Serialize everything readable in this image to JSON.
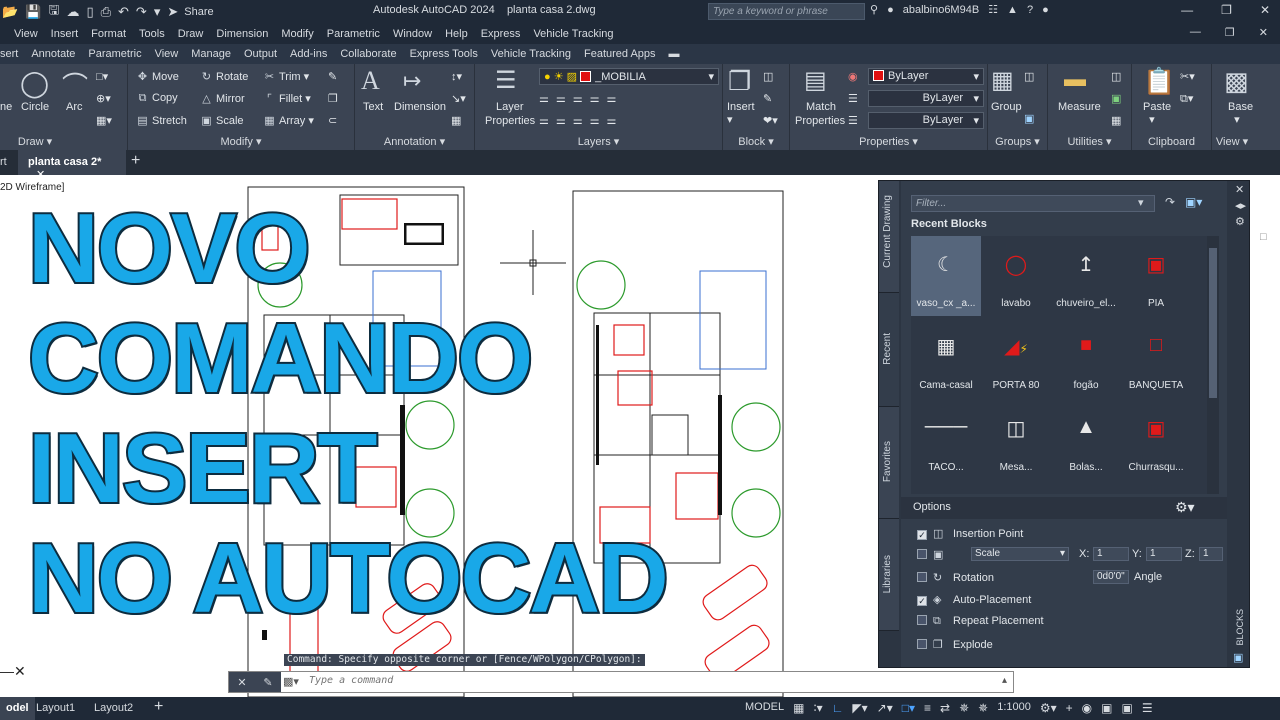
{
  "titlebar": {
    "share": "Share",
    "app_title": "Autodesk AutoCAD 2024",
    "file_name": "planta casa 2.dwg",
    "search_placeholder": "Type a keyword or phrase",
    "user": "abalbino6M94B"
  },
  "menu": [
    "View",
    "Insert",
    "Format",
    "Tools",
    "Draw",
    "Dimension",
    "Modify",
    "Parametric",
    "Window",
    "Help",
    "Express",
    "Vehicle Tracking"
  ],
  "ribbon_tabs": [
    "sert",
    "Annotate",
    "Parametric",
    "View",
    "Manage",
    "Output",
    "Add-ins",
    "Collaborate",
    "Express Tools",
    "Vehicle Tracking",
    "Featured Apps"
  ],
  "ribbon": {
    "draw": {
      "title": "Draw",
      "line": "ne",
      "circle": "Circle",
      "arc": "Arc"
    },
    "modify": {
      "title": "Modify",
      "move": "Move",
      "rotate": "Rotate",
      "trim": "Trim",
      "copy": "Copy",
      "mirror": "Mirror",
      "fillet": "Fillet",
      "stretch": "Stretch",
      "scale": "Scale",
      "array": "Array"
    },
    "annotation": {
      "title": "Annotation",
      "text": "Text",
      "dimension": "Dimension"
    },
    "layers": {
      "title": "Layers",
      "properties_line1": "Layer",
      "properties_line2": "Properties",
      "current_layer": "_MOBILIA"
    },
    "block": {
      "title": "Block",
      "insert": "Insert"
    },
    "properties": {
      "title": "Properties",
      "match_line1": "Match",
      "match_line2": "Properties",
      "color": "ByLayer",
      "linetype": "ByLayer",
      "lineweight": "ByLayer"
    },
    "groups": {
      "title": "Groups",
      "group": "Group"
    },
    "utilities": {
      "title": "Utilities",
      "measure": "Measure"
    },
    "clipboard": {
      "title": "Clipboard",
      "paste": "Paste"
    },
    "view": {
      "title": "View",
      "base": "Base"
    }
  },
  "doc_tabs": {
    "start": "rt",
    "active": "planta casa 2*"
  },
  "viewport_label": "2D Wireframe]",
  "overlay_text": [
    "NOVO",
    "COMANDO",
    "INSERT",
    "NO AUTOCAD"
  ],
  "blocks_palette": {
    "side_tabs": [
      "Current Drawing",
      "Recent",
      "Favorites",
      "Libraries"
    ],
    "filter_placeholder": "Filter...",
    "recent_title": "Recent Blocks",
    "blocks": [
      {
        "name": "vaso_cx _a...",
        "icon": "toilet-icon"
      },
      {
        "name": "lavabo",
        "icon": "sink-icon"
      },
      {
        "name": "chuveiro_el...",
        "icon": "shower-icon"
      },
      {
        "name": "PIA",
        "icon": "kitchen-sink-icon"
      },
      {
        "name": "Cama-casal",
        "icon": "bed-icon"
      },
      {
        "name": "PORTA 80",
        "icon": "door-icon"
      },
      {
        "name": "fogão",
        "icon": "stove-icon"
      },
      {
        "name": "BANQUETA",
        "icon": "stool-icon"
      },
      {
        "name": "TACO...",
        "icon": "line-icon"
      },
      {
        "name": "Mesa...",
        "icon": "table-icon"
      },
      {
        "name": "Bolas...",
        "icon": "balls-icon"
      },
      {
        "name": "Churrasqu...",
        "icon": "grill-icon"
      }
    ],
    "options_title": "Options",
    "options": {
      "insertion_point": "Insertion Point",
      "scale": "Scale",
      "scale_x_label": "X:",
      "scale_x": "1",
      "scale_y_label": "Y:",
      "scale_y": "1",
      "scale_z_label": "Z:",
      "scale_z": "1",
      "rotation": "Rotation",
      "rotation_value": "0d0'0\"",
      "angle": "Angle",
      "auto_placement": "Auto-Placement",
      "repeat_placement": "Repeat Placement",
      "explode": "Explode"
    },
    "side_label": "BLOCKS"
  },
  "command": {
    "history": "Command: Specify opposite corner or [Fence/WPolygon/CPolygon]:",
    "placeholder": "Type a command"
  },
  "statusbar": {
    "model_tab": "odel",
    "layout1": "Layout1",
    "layout2": "Layout2",
    "model_button": "MODEL",
    "scale": "1:1000"
  }
}
